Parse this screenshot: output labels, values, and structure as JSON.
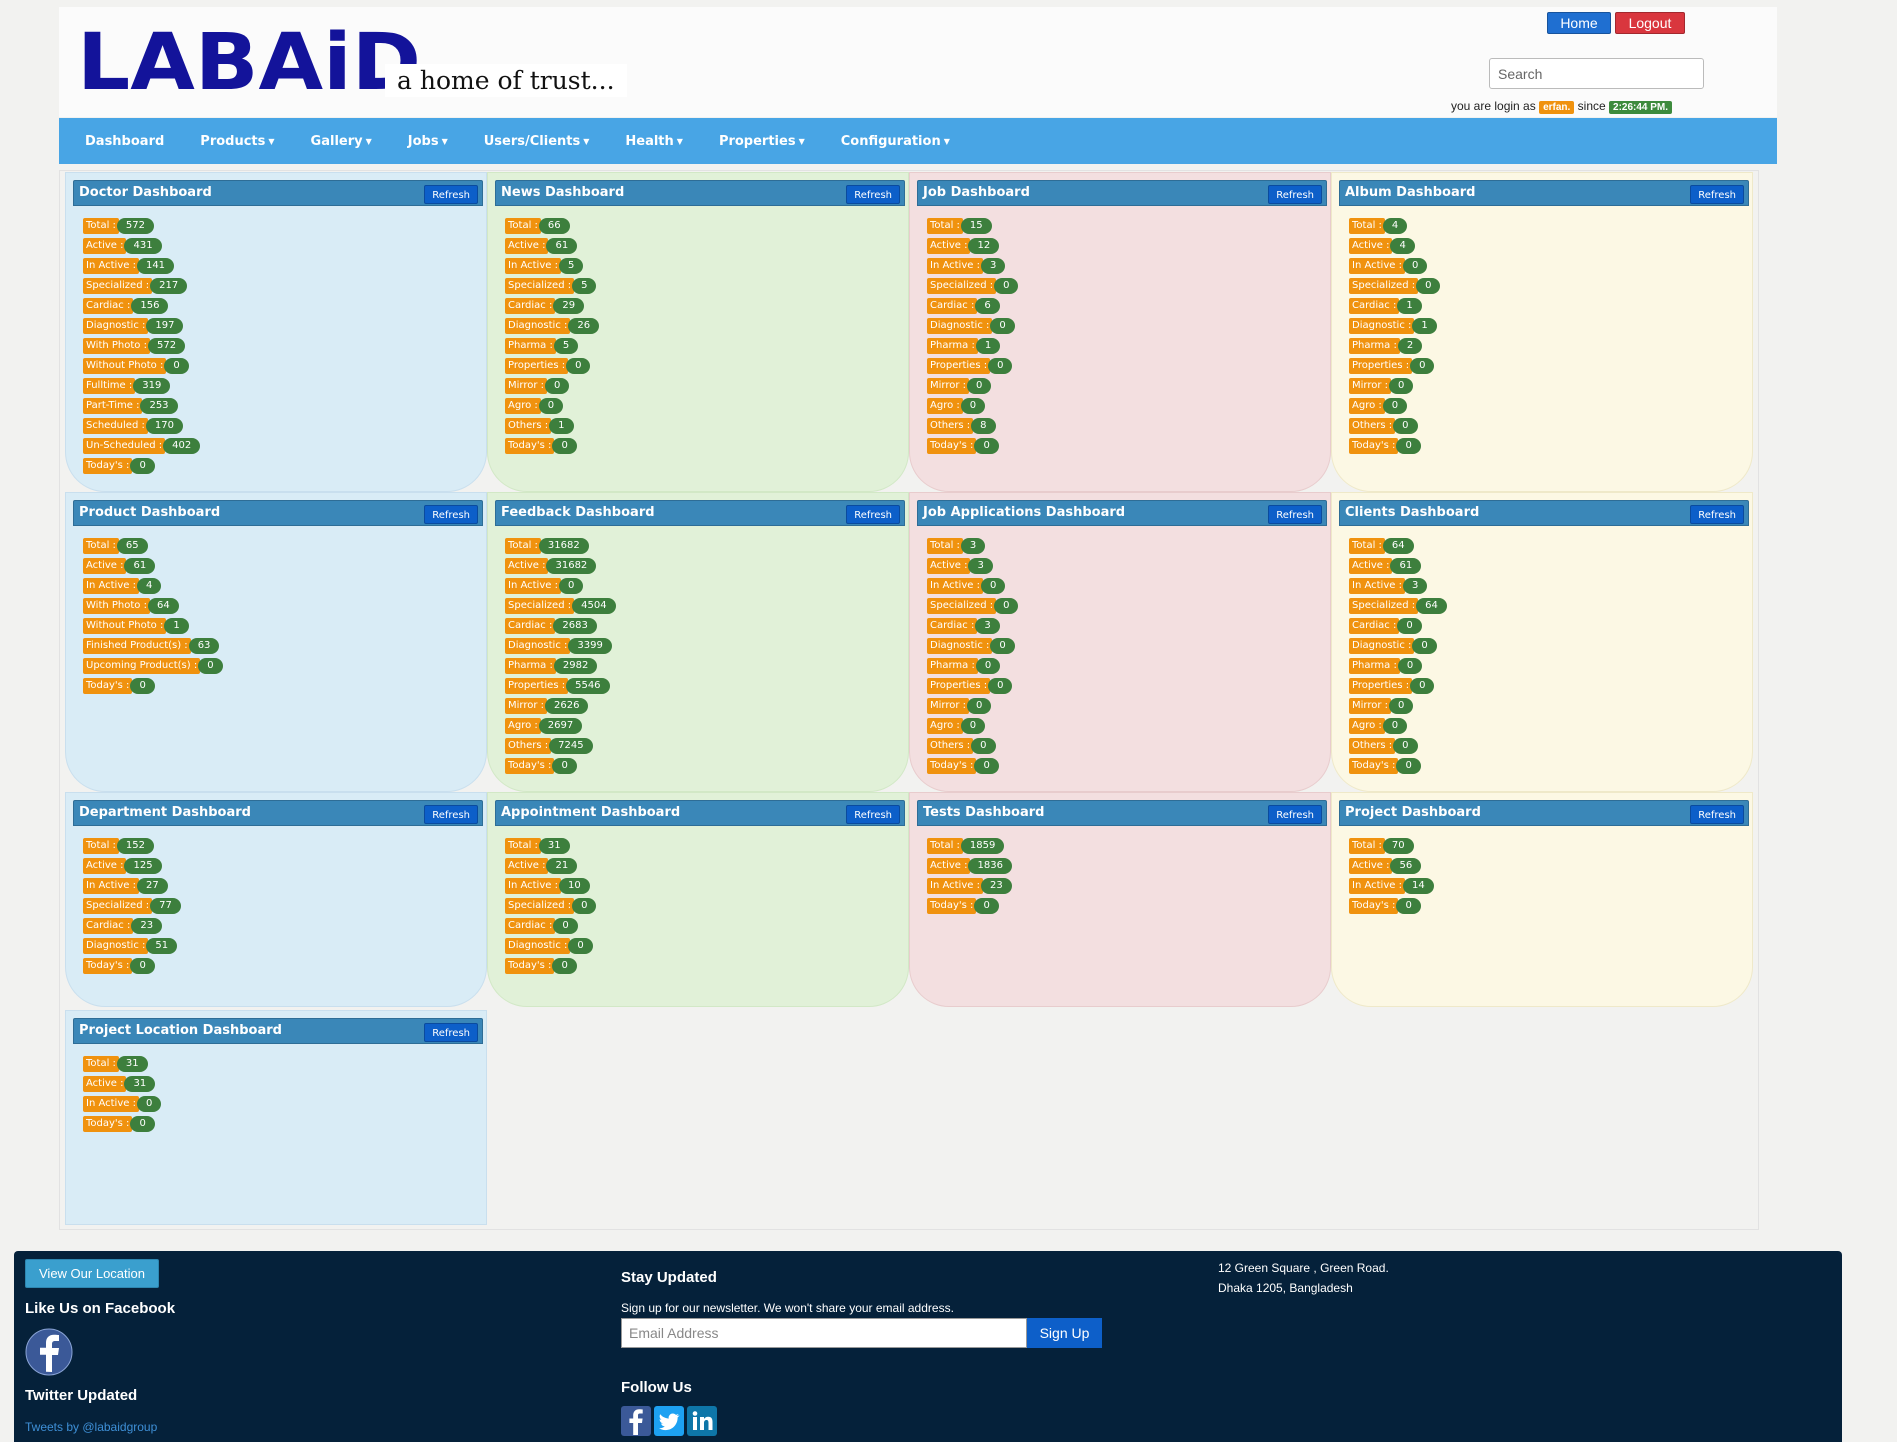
{
  "header": {
    "logo_text": "LABAiD",
    "tagline": "a home of trust...",
    "home_label": "Home",
    "logout_label": "Logout",
    "search_placeholder": "Search",
    "login_prefix": "you are login as",
    "login_user": "erfan.",
    "login_since": "since",
    "login_time": "2:26:44 PM."
  },
  "nav": {
    "items": [
      {
        "label": "Dashboard",
        "dropdown": false
      },
      {
        "label": "Products",
        "dropdown": true
      },
      {
        "label": "Gallery",
        "dropdown": true
      },
      {
        "label": "Jobs",
        "dropdown": true
      },
      {
        "label": "Users/Clients",
        "dropdown": true
      },
      {
        "label": "Health",
        "dropdown": true
      },
      {
        "label": "Properties",
        "dropdown": true
      },
      {
        "label": "Configuration",
        "dropdown": true
      }
    ]
  },
  "refresh_label": "Refresh",
  "colors": {
    "blue": "#d9ecf6",
    "green": "#e1f1d8",
    "red": "#f3dfe0",
    "yellow": "#fcf8e4",
    "label": "#f0920e",
    "badge": "#3d7f3d",
    "nav": "#48a5e5"
  },
  "panels": [
    {
      "title": "Doctor Dashboard",
      "color": "blue",
      "stats": [
        [
          "Total :",
          "572"
        ],
        [
          "Active :",
          "431"
        ],
        [
          "In Active :",
          "141"
        ],
        [
          "Specialized :",
          "217"
        ],
        [
          "Cardiac :",
          "156"
        ],
        [
          "Diagnostic :",
          "197"
        ],
        [
          "With Photo :",
          "572"
        ],
        [
          "Without Photo :",
          "0"
        ],
        [
          "Fulltime :",
          "319"
        ],
        [
          "Part-Time :",
          "253"
        ],
        [
          "Scheduled :",
          "170"
        ],
        [
          "Un-Scheduled :",
          "402"
        ],
        [
          "Today's :",
          "0"
        ]
      ]
    },
    {
      "title": "News Dashboard",
      "color": "green",
      "stats": [
        [
          "Total :",
          "66"
        ],
        [
          "Active :",
          "61"
        ],
        [
          "In Active :",
          "5"
        ],
        [
          "Specialized :",
          "5"
        ],
        [
          "Cardiac :",
          "29"
        ],
        [
          "Diagnostic :",
          "26"
        ],
        [
          "Pharma :",
          "5"
        ],
        [
          "Properties :",
          "0"
        ],
        [
          "Mirror :",
          "0"
        ],
        [
          "Agro :",
          "0"
        ],
        [
          "Others :",
          "1"
        ],
        [
          "Today's :",
          "0"
        ]
      ]
    },
    {
      "title": "Job Dashboard",
      "color": "red",
      "stats": [
        [
          "Total :",
          "15"
        ],
        [
          "Active :",
          "12"
        ],
        [
          "In Active :",
          "3"
        ],
        [
          "Specialized :",
          "0"
        ],
        [
          "Cardiac :",
          "6"
        ],
        [
          "Diagnostic :",
          "0"
        ],
        [
          "Pharma :",
          "1"
        ],
        [
          "Properties :",
          "0"
        ],
        [
          "Mirror :",
          "0"
        ],
        [
          "Agro :",
          "0"
        ],
        [
          "Others :",
          "8"
        ],
        [
          "Today's :",
          "0"
        ]
      ]
    },
    {
      "title": "Album Dashboard",
      "color": "yellow",
      "stats": [
        [
          "Total :",
          "4"
        ],
        [
          "Active :",
          "4"
        ],
        [
          "In Active :",
          "0"
        ],
        [
          "Specialized :",
          "0"
        ],
        [
          "Cardiac :",
          "1"
        ],
        [
          "Diagnostic :",
          "1"
        ],
        [
          "Pharma :",
          "2"
        ],
        [
          "Properties :",
          "0"
        ],
        [
          "Mirror :",
          "0"
        ],
        [
          "Agro :",
          "0"
        ],
        [
          "Others :",
          "0"
        ],
        [
          "Today's :",
          "0"
        ]
      ]
    },
    {
      "title": "Product Dashboard",
      "color": "blue",
      "stats": [
        [
          "Total :",
          "65"
        ],
        [
          "Active :",
          "61"
        ],
        [
          "In Active :",
          "4"
        ],
        [
          "With Photo :",
          "64"
        ],
        [
          "Without Photo :",
          "1"
        ],
        [
          "Finished Product(s) :",
          "63"
        ],
        [
          "Upcoming Product(s) :",
          "0"
        ],
        [
          "Today's :",
          "0"
        ]
      ]
    },
    {
      "title": "Feedback Dashboard",
      "color": "green",
      "stats": [
        [
          "Total :",
          "31682"
        ],
        [
          "Active :",
          "31682"
        ],
        [
          "In Active :",
          "0"
        ],
        [
          "Specialized :",
          "4504"
        ],
        [
          "Cardiac :",
          "2683"
        ],
        [
          "Diagnostic :",
          "3399"
        ],
        [
          "Pharma :",
          "2982"
        ],
        [
          "Properties :",
          "5546"
        ],
        [
          "Mirror :",
          "2626"
        ],
        [
          "Agro :",
          "2697"
        ],
        [
          "Others :",
          "7245"
        ],
        [
          "Today's :",
          "0"
        ]
      ]
    },
    {
      "title": "Job Applications Dashboard",
      "color": "red",
      "stats": [
        [
          "Total :",
          "3"
        ],
        [
          "Active :",
          "3"
        ],
        [
          "In Active :",
          "0"
        ],
        [
          "Specialized :",
          "0"
        ],
        [
          "Cardiac :",
          "3"
        ],
        [
          "Diagnostic :",
          "0"
        ],
        [
          "Pharma :",
          "0"
        ],
        [
          "Properties :",
          "0"
        ],
        [
          "Mirror :",
          "0"
        ],
        [
          "Agro :",
          "0"
        ],
        [
          "Others :",
          "0"
        ],
        [
          "Today's :",
          "0"
        ]
      ]
    },
    {
      "title": "Clients Dashboard",
      "color": "yellow",
      "stats": [
        [
          "Total :",
          "64"
        ],
        [
          "Active :",
          "61"
        ],
        [
          "In Active :",
          "3"
        ],
        [
          "Specialized :",
          "64"
        ],
        [
          "Cardiac :",
          "0"
        ],
        [
          "Diagnostic :",
          "0"
        ],
        [
          "Pharma :",
          "0"
        ],
        [
          "Properties :",
          "0"
        ],
        [
          "Mirror :",
          "0"
        ],
        [
          "Agro :",
          "0"
        ],
        [
          "Others :",
          "0"
        ],
        [
          "Today's :",
          "0"
        ]
      ]
    },
    {
      "title": "Department Dashboard",
      "color": "blue",
      "stats": [
        [
          "Total :",
          "152"
        ],
        [
          "Active :",
          "125"
        ],
        [
          "In Active :",
          "27"
        ],
        [
          "Specialized :",
          "77"
        ],
        [
          "Cardiac :",
          "23"
        ],
        [
          "Diagnostic :",
          "51"
        ],
        [
          "Today's :",
          "0"
        ]
      ]
    },
    {
      "title": "Appointment Dashboard",
      "color": "green",
      "stats": [
        [
          "Total :",
          "31"
        ],
        [
          "Active :",
          "21"
        ],
        [
          "In Active :",
          "10"
        ],
        [
          "Specialized :",
          "0"
        ],
        [
          "Cardiac :",
          "0"
        ],
        [
          "Diagnostic :",
          "0"
        ],
        [
          "Today's :",
          "0"
        ]
      ]
    },
    {
      "title": "Tests Dashboard",
      "color": "red",
      "stats": [
        [
          "Total :",
          "1859"
        ],
        [
          "Active :",
          "1836"
        ],
        [
          "In Active :",
          "23"
        ],
        [
          "Today's :",
          "0"
        ]
      ]
    },
    {
      "title": "Project Dashboard",
      "color": "yellow",
      "stats": [
        [
          "Total :",
          "70"
        ],
        [
          "Active :",
          "56"
        ],
        [
          "In Active :",
          "14"
        ],
        [
          "Today's :",
          "0"
        ]
      ]
    },
    {
      "title": "Project Location Dashboard",
      "color": "blue",
      "stats": [
        [
          "Total :",
          "31"
        ],
        [
          "Active :",
          "31"
        ],
        [
          "In Active :",
          "0"
        ],
        [
          "Today's :",
          "0"
        ]
      ]
    }
  ],
  "footer": {
    "location_button": "View Our Location",
    "facebook_heading": "Like Us on Facebook",
    "twitter_heading": "Twitter Updated",
    "tweets_link": "Tweets by @labaidgroup",
    "stay_heading": "Stay Updated",
    "newsletter_text": "Sign up for our newsletter. We won't share your email address.",
    "email_placeholder": "Email Address",
    "signup_label": "Sign Up",
    "follow_heading": "Follow Us",
    "address_line1": "12 Green Square , Green Road.",
    "address_line2": "Dhaka 1205, Bangladesh"
  }
}
